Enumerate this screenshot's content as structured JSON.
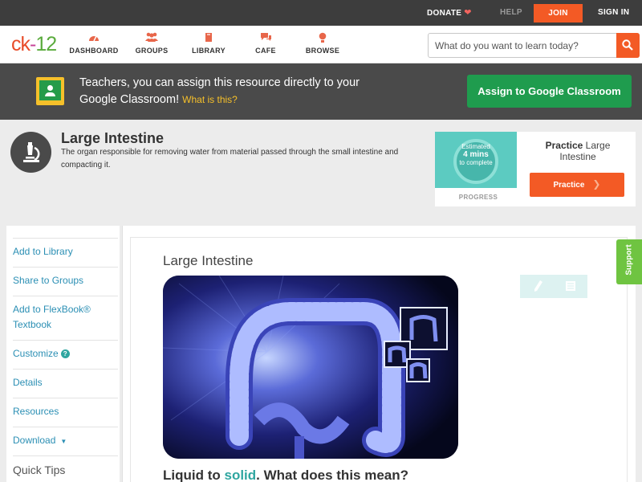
{
  "topbar": {
    "donate": "DONATE",
    "help": "HELP",
    "join": "JOIN",
    "signin": "SIGN IN"
  },
  "logo": {
    "ck": "ck",
    "dash": "-",
    "num": "12"
  },
  "nav": {
    "items": [
      {
        "label": "DASHBOARD",
        "icon": "dashboard-icon"
      },
      {
        "label": "GROUPS",
        "icon": "groups-icon"
      },
      {
        "label": "LIBRARY",
        "icon": "library-icon"
      },
      {
        "label": "CAFE",
        "icon": "cafe-icon"
      },
      {
        "label": "BROWSE",
        "icon": "browse-icon"
      }
    ],
    "search_placeholder": "What do you want to learn today?"
  },
  "banner": {
    "text": "Teachers, you can assign this resource directly to your Google Classroom!",
    "what_link": "What is this?",
    "assign_button": "Assign to Google Classroom"
  },
  "concept": {
    "title": "Large Intestine",
    "description": "The organ responsible for removing water from material passed through the small intestine and compacting it."
  },
  "practice": {
    "estimated": "Estimated",
    "minutes": "4 mins",
    "to_complete": "to complete",
    "progress_label": "PROGRESS",
    "title_bold": "Practice",
    "title_rest": "Large Intestine",
    "button": "Practice"
  },
  "sidebar": {
    "items": [
      {
        "label": "Add to Library"
      },
      {
        "label": "Share to Groups"
      },
      {
        "label": "Add to FlexBook® Textbook"
      },
      {
        "label": "Customize"
      },
      {
        "label": "Details"
      },
      {
        "label": "Resources"
      },
      {
        "label": "Download"
      }
    ],
    "quick_tips": "Quick Tips"
  },
  "main": {
    "title": "Large Intestine",
    "lead_start": "Liquid to ",
    "lead_highlight": "solid",
    "lead_end": ". What does this mean?"
  },
  "support": "Support",
  "colors": {
    "accent": "#f35a25",
    "google_green": "#1f9c4e",
    "teal": "#2fa6a0",
    "link": "#2b8fb4",
    "support": "#6fc441"
  }
}
